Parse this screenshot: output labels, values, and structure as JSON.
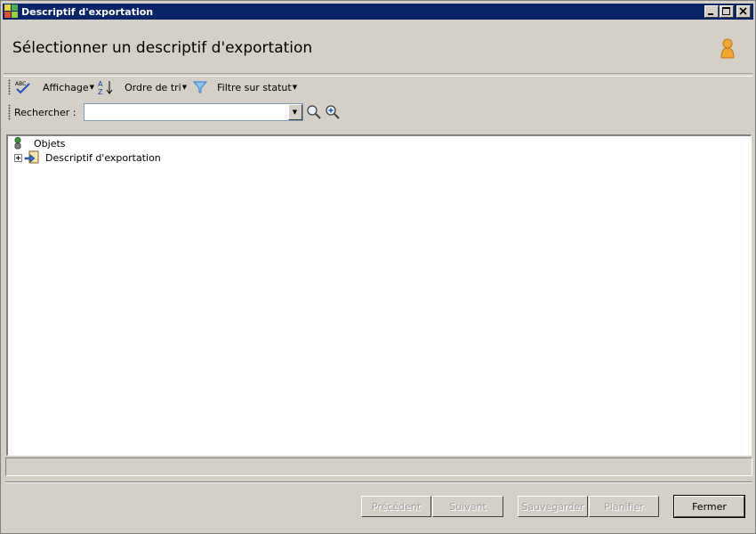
{
  "window": {
    "title": "Descriptif d'exportation"
  },
  "header": {
    "title": "Sélectionner un descriptif d'exportation",
    "user_icon": "user-icon"
  },
  "toolbar": {
    "spellcheck_icon": "abc-check-icon",
    "display_label": "Affichage",
    "sort_icon": "sort-az-icon",
    "sort_label": "Ordre de tri",
    "filter_icon": "funnel-icon",
    "filter_label": "Filtre sur statut"
  },
  "search": {
    "label": "Rechercher :",
    "value": "",
    "placeholder": ""
  },
  "tree": {
    "root": {
      "label": "Objets",
      "icon": "objects-icon"
    },
    "children": [
      {
        "label": "Descriptif d'exportation",
        "icon": "export-descriptor-icon",
        "expanded": false
      }
    ]
  },
  "buttons": {
    "previous": "Précédent",
    "next": "Suivant",
    "save": "Sauvegarder",
    "schedule": "Planifier",
    "close": "Fermer"
  },
  "colors": {
    "titlebar": "#0a246a",
    "window": "#d4d0c8",
    "filter_blue": "#2f7fd8"
  }
}
